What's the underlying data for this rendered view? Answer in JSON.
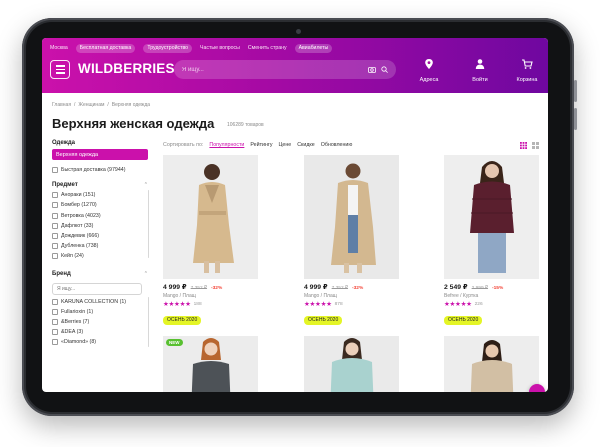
{
  "header": {
    "top_links": [
      "Москва",
      "Бесплатная доставка",
      "Трудоустройство",
      "Частые вопросы",
      "Сменить страну",
      "Авиабилеты"
    ],
    "logo": "WILDBERRIES",
    "search_placeholder": "Я ищу...",
    "actions": [
      {
        "label": "Адреса",
        "icon": "location-pin-icon"
      },
      {
        "label": "Войти",
        "icon": "user-icon"
      },
      {
        "label": "Корзина",
        "icon": "cart-icon"
      }
    ],
    "colors": {
      "accent": "#cb11ab",
      "gradient_end": "#6f07a0"
    }
  },
  "breadcrumb": [
    "Главная",
    "/",
    "Женщинам",
    "/",
    "Верхняя одежда"
  ],
  "title": "Верхняя женская одежда",
  "count": "106289 товаров",
  "sidebar": {
    "category_title": "Одежда",
    "category_active": "Верхняя одежда",
    "fast_delivery": "Быстрая доставка (97944)",
    "subject_title": "Предмет",
    "subjects": [
      "Анораки (151)",
      "Бомбер (1270)",
      "Ветровка (4023)",
      "Дафлкот (33)",
      "Дождевик (666)",
      "Дубленка (738)",
      "Кейп (24)"
    ],
    "brand_title": "Бренд",
    "brand_search_placeholder": "Я ищу...",
    "brands": [
      "KARUNA COLLECTION (1)",
      "Fullarioxin (1)",
      "&Berries (7)",
      "&DEA (3)",
      "«Diamond» (8)"
    ]
  },
  "sort": {
    "label": "Сортировать по:",
    "options": [
      "Популярности",
      "Рейтингу",
      "Цене",
      "Скидке",
      "Обновлению"
    ],
    "active_index": 0
  },
  "products": [
    {
      "price": "4 999 ₽",
      "old_price": "7 352 ₽",
      "discount": "-32%",
      "brand": "Mango / Плащ",
      "stars": "★★★★★",
      "rating": 5,
      "reviews": "188",
      "season": "ОСЕНЬ 2020"
    },
    {
      "price": "4 999 ₽",
      "old_price": "7 352 ₽",
      "discount": "-32%",
      "brand": "Mango / Плащ",
      "stars": "★★★★★",
      "rating": 5,
      "reviews": "878",
      "season": "ОСЕНЬ 2020"
    },
    {
      "price": "2 549 ₽",
      "old_price": "2 999 ₽",
      "discount": "-15%",
      "brand": "Befree / Куртка",
      "stars": "★★★★★",
      "rating": 5,
      "reviews": "226",
      "season": "ОСЕНЬ 2020"
    },
    {
      "badge": "NEW"
    },
    {},
    {}
  ]
}
